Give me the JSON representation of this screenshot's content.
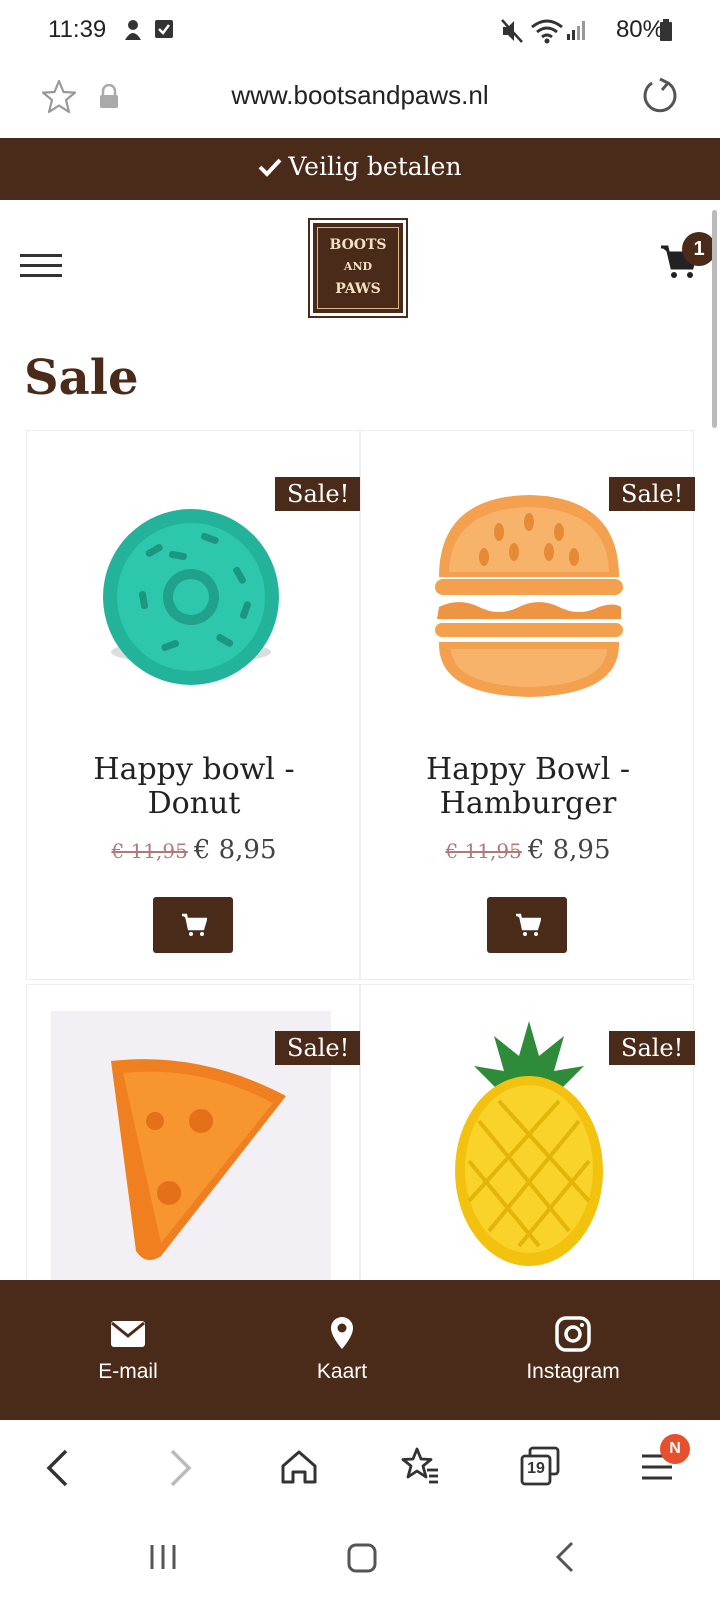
{
  "status_bar": {
    "time": "11:39",
    "battery": "80%"
  },
  "url_bar": {
    "url": "www.bootsandpaws.nl"
  },
  "banner": {
    "text": "Veilig betalen"
  },
  "header": {
    "cart_count": "1"
  },
  "page": {
    "title": "Sale"
  },
  "products": [
    {
      "sale_label": "Sale!",
      "name_line1": "Happy bowl -",
      "name_line2": "Donut",
      "old_price": "€ 11,95",
      "price": "€ 8,95",
      "image_icon": "donut-bowl-image"
    },
    {
      "sale_label": "Sale!",
      "name_line1": "Happy Bowl -",
      "name_line2": "Hamburger",
      "old_price": "€ 11,95",
      "price": "€ 8,95",
      "image_icon": "hamburger-bowl-image"
    },
    {
      "sale_label": "Sale!",
      "image_icon": "pizza-bowl-image"
    },
    {
      "sale_label": "Sale!",
      "image_icon": "pineapple-bowl-image"
    }
  ],
  "footer": {
    "items": [
      {
        "label": "E-mail",
        "icon": "envelope-icon"
      },
      {
        "label": "Kaart",
        "icon": "map-pin-icon"
      },
      {
        "label": "Instagram",
        "icon": "instagram-icon"
      }
    ]
  },
  "browser_toolbar": {
    "tabs_count": "19",
    "menu_badge": "N"
  },
  "colors": {
    "brand_brown": "#4a2a18",
    "badge_orange": "#e7502c"
  }
}
